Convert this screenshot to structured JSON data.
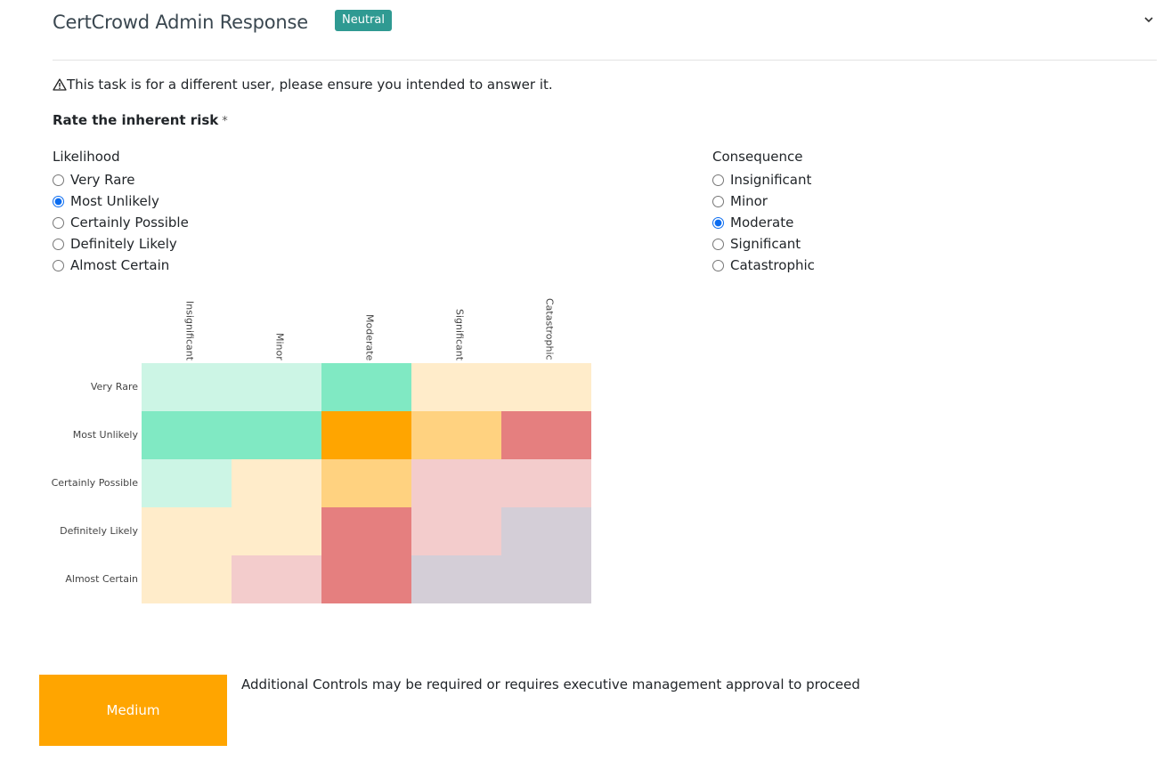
{
  "header": {
    "title": "CertCrowd Admin Response",
    "badge": "Neutral",
    "badge_color": "#2f9a92",
    "collapse_icon": "chevron-down-icon"
  },
  "warning": {
    "icon": "warning-triangle-icon",
    "text": "This task is for a different user, please ensure you intended to answer it."
  },
  "question": {
    "label": "Rate the inherent risk",
    "required_marker": "*"
  },
  "likelihood": {
    "label": "Likelihood",
    "options": [
      "Very Rare",
      "Most Unlikely",
      "Certainly Possible",
      "Definitely Likely",
      "Almost Certain"
    ],
    "selected": "Most Unlikely"
  },
  "consequence": {
    "label": "Consequence",
    "options": [
      "Insignificant",
      "Minor",
      "Moderate",
      "Significant",
      "Catastrophic"
    ],
    "selected": "Moderate"
  },
  "chart_data": {
    "type": "heatmap",
    "title": "",
    "x": [
      "Insignificant",
      "Minor",
      "Moderate",
      "Significant",
      "Catastrophic"
    ],
    "y": [
      "Very Rare",
      "Most Unlikely",
      "Certainly Possible",
      "Definitely Likely",
      "Almost Certain"
    ],
    "cell_colors": [
      [
        "#ccf5e5",
        "#ccf5e5",
        "#80e9c3",
        "#ffecca",
        "#ffecca"
      ],
      [
        "#80e9c3",
        "#80e9c3",
        "#ffa500",
        "#ffd280",
        "#e57f7f"
      ],
      [
        "#ccf5e5",
        "#ffecca",
        "#ffd280",
        "#f3cccc",
        "#f3cccc"
      ],
      [
        "#ffecca",
        "#ffecca",
        "#e57f7f",
        "#f3cccc",
        "#d4ced7"
      ],
      [
        "#ffecca",
        "#f3cccc",
        "#e57f7f",
        "#d4ced7",
        "#d4ced7"
      ]
    ],
    "highlighted": {
      "likelihood": "Most Unlikely",
      "consequence": "Moderate"
    }
  },
  "result": {
    "level": "Medium",
    "color": "#ffa500",
    "description": "Additional Controls may be required or requires executive management approval to proceed"
  }
}
